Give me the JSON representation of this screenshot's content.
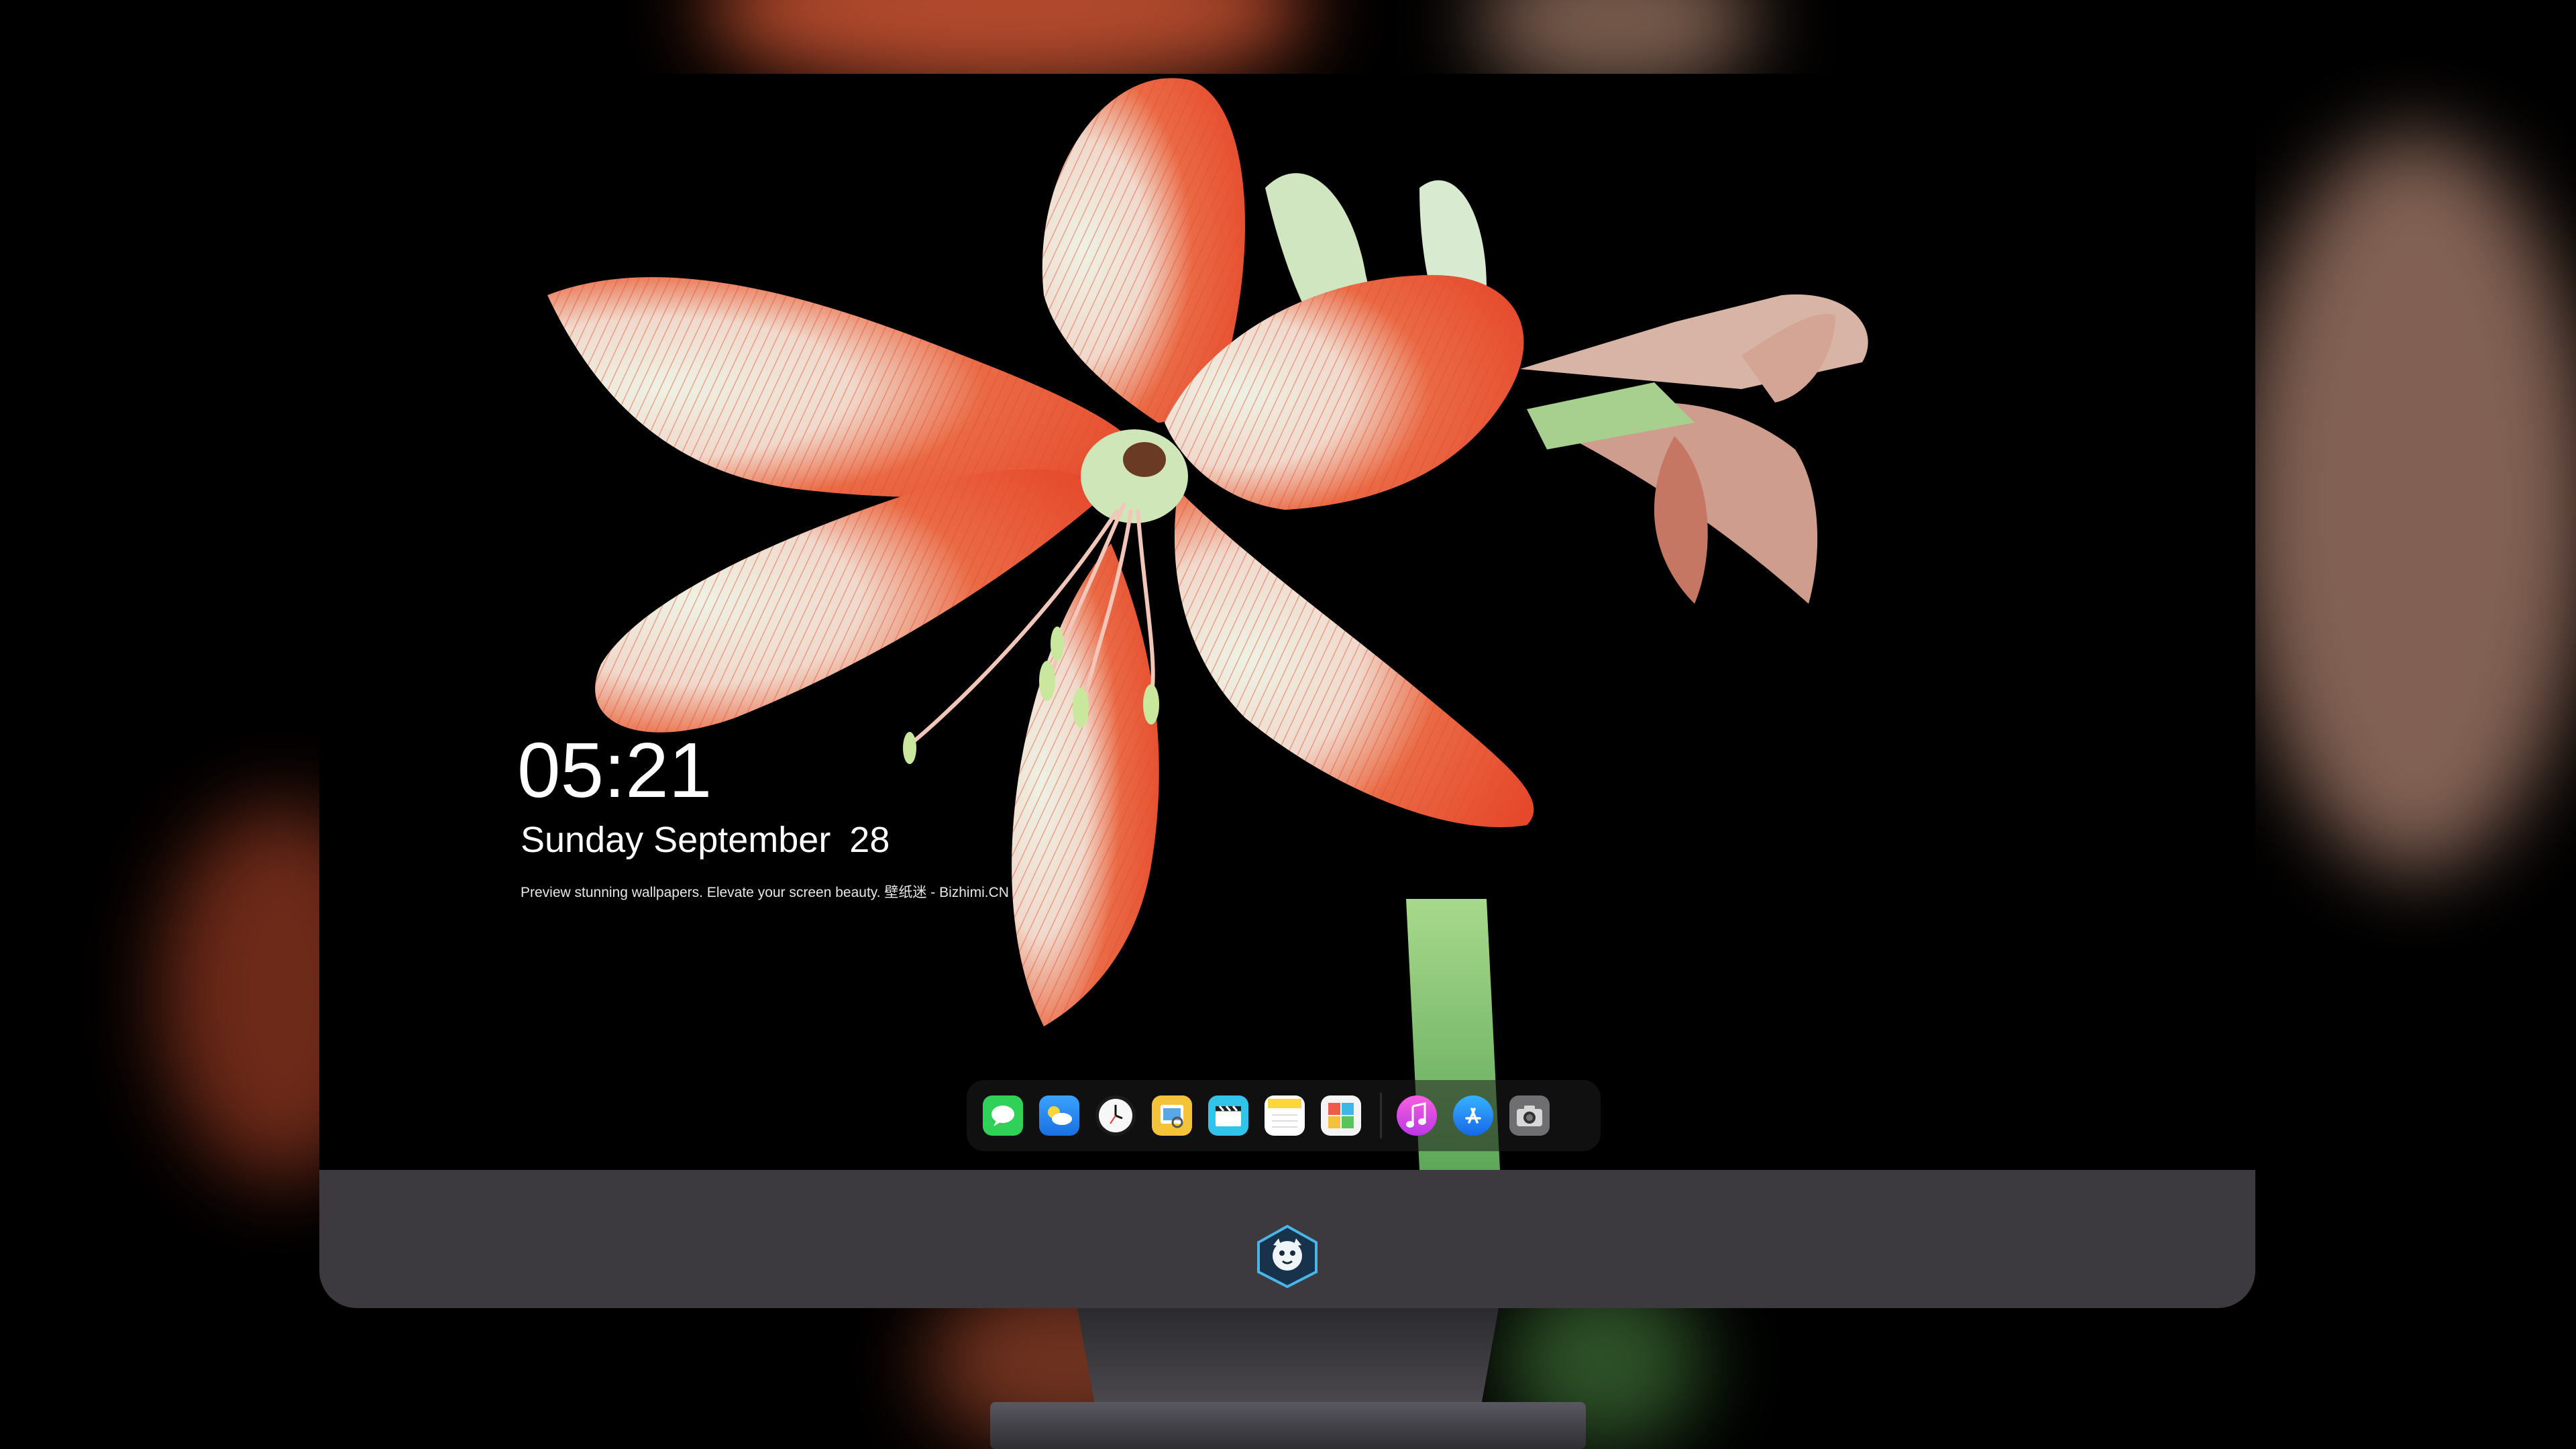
{
  "lockscreen": {
    "time": "05:21",
    "weekday_month": "Sunday September",
    "day": "28",
    "caption": "Preview stunning wallpapers. Elevate your screen beauty. 壁纸迷 - Bizhimi.CN"
  },
  "dock": {
    "apps": [
      {
        "icon": "messages-icon",
        "color": "#2fd158"
      },
      {
        "icon": "weather-icon",
        "color": "#1e8ef5"
      },
      {
        "icon": "clock-icon",
        "color": "#f2f2f2"
      },
      {
        "icon": "preview-icon",
        "color": "#f3c33a"
      },
      {
        "icon": "video-editor-icon",
        "color": "#32c4e8"
      },
      {
        "icon": "notes-icon",
        "color": "#ffd53c"
      },
      {
        "icon": "photo-collage-icon",
        "color": "#f4f4f4"
      },
      {
        "icon": "music-icon",
        "color": "#e940d6"
      },
      {
        "icon": "app-store-icon",
        "color": "#1d86f5"
      },
      {
        "icon": "camera-icon",
        "color": "#6f6f72"
      }
    ]
  },
  "colors": {
    "chin": "#3c3a3f",
    "petal_red": "#e5482b",
    "petal_white": "#ece8de",
    "stem_green": "#7ebf6b"
  }
}
